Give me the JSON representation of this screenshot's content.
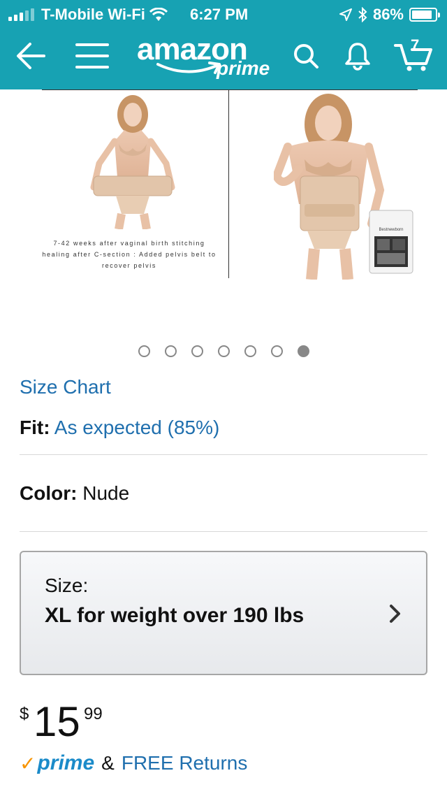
{
  "status_bar": {
    "carrier": "T-Mobile Wi-Fi",
    "time": "6:27 PM",
    "battery": "86%",
    "battery_level": 0.86
  },
  "nav": {
    "logo_main": "amazon",
    "logo_sub": "prime",
    "cart_count": "7",
    "icons": [
      "back-arrow-icon",
      "menu-icon",
      "search-icon",
      "bell-icon",
      "cart-icon"
    ]
  },
  "gallery": {
    "caption": "7-42 weeks after vaginal birth stitching healing after C-section : Added pelvis belt to recover pelvis",
    "package_label": "Bestnewborn",
    "image_count": 7,
    "active_index": 6
  },
  "product": {
    "size_chart_link": "Size Chart",
    "fit_label": "Fit:",
    "fit_value": "As expected (85%)",
    "color_label": "Color:",
    "color_value": "Nude",
    "size_label": "Size:",
    "size_value": "XL for weight over 190 lbs",
    "price_currency": "$",
    "price_whole": "15",
    "price_fraction": "99",
    "prime_check": "✓",
    "prime_word": "prime",
    "returns_amp": "&",
    "returns_link": "FREE Returns"
  },
  "colors": {
    "header": "#17a2b3",
    "link": "#1f6fae",
    "prime_check": "#f79400",
    "prime_word": "#1b8bc9"
  }
}
